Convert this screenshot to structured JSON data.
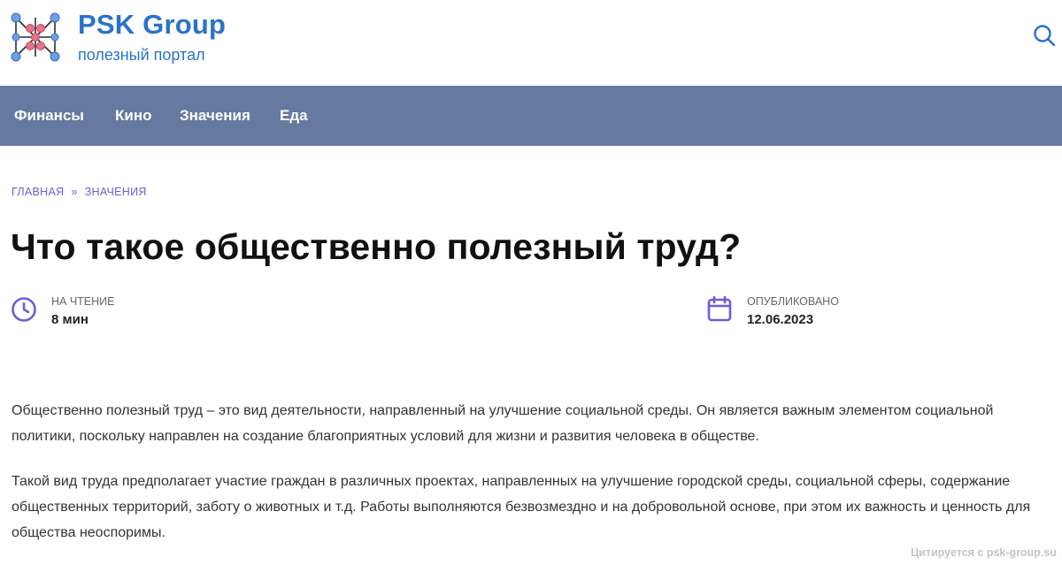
{
  "site": {
    "title": "PSK Group",
    "tagline": "полезный портал"
  },
  "nav": {
    "items": [
      {
        "label": "Финансы"
      },
      {
        "label": "Кино"
      },
      {
        "label": "Значения"
      },
      {
        "label": "Еда"
      }
    ]
  },
  "breadcrumb": {
    "home": "ГЛАВНАЯ",
    "separator": "»",
    "current": "ЗНАЧЕНИЯ"
  },
  "article": {
    "title": "Что такое общественно полезный труд?",
    "reading": {
      "label": "НА ЧТЕНИЕ",
      "value": "8 мин",
      "icon": "clock-icon"
    },
    "published": {
      "label": "ОПУБЛИКОВАНО",
      "value": "12.06.2023",
      "icon": "calendar-icon"
    },
    "paragraphs": [
      "Общественно полезный труд – это вид деятельности, направленный на улучшение социальной среды. Он является важным элементом социальной политики, поскольку направлен на создание благоприятных условий для жизни и развития человека в обществе.",
      "Такой вид труда предполагает участие граждан в различных проектах, направленных на улучшение городской среды, социальной сферы, содержание общественных территорий, заботу о животных и т.д. Работы выполняются безвозмездно и на добровольной основе, при этом их важность и ценность для общества неоспоримы."
    ]
  },
  "watermark": "Цитируется с psk-group.su",
  "colors": {
    "brand": "#2a73c9",
    "nav_bg": "#6679a0",
    "accent": "#6f5cd6"
  }
}
